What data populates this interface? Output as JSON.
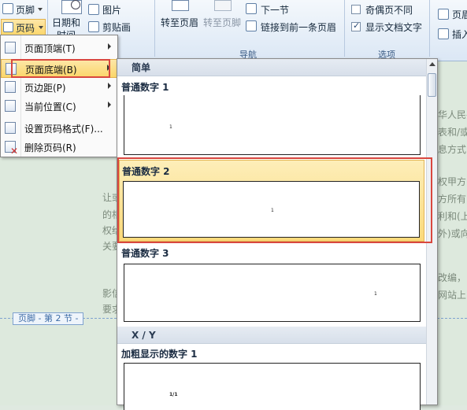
{
  "ribbon": {
    "header_footer": {
      "footer_label": "页脚",
      "page_number_label": "页码"
    },
    "insert": {
      "date_time_label": "日期和",
      "date_time_label2": "时间",
      "picture_label": "图片",
      "clipart_label": "剪贴画"
    },
    "nav": {
      "goto_header": "转至页眉",
      "goto_footer": "转至页脚",
      "next_section": "下一节",
      "link_previous": "链接到前一条页眉",
      "group_label": "导航"
    },
    "options": {
      "odd_even": "奇偶页不同",
      "show_doc_text": "显示文档文字",
      "group_label": "选项"
    },
    "position": {
      "header_label": "页眉",
      "insert_label": "插入"
    }
  },
  "menu": {
    "items": [
      {
        "label": "页面顶端(T)",
        "icon": "page-top-icon",
        "has_submenu": true
      },
      {
        "label": "页面底端(B)",
        "icon": "page-bottom-icon",
        "has_submenu": true
      },
      {
        "label": "页边距(P)",
        "icon": "page-margin-icon",
        "has_submenu": true
      },
      {
        "label": "当前位置(C)",
        "icon": "current-position-icon",
        "has_submenu": true
      },
      {
        "label": "设置页码格式(F)...",
        "icon": "format-page-number-icon",
        "has_submenu": false
      },
      {
        "label": "删除页码(R)",
        "icon": "delete-page-number-icon",
        "has_submenu": false
      }
    ]
  },
  "gallery": {
    "section_simple": "简单",
    "item1": "普通数字 1",
    "item2": "普通数字 2",
    "item3": "普通数字 3",
    "section_xy": "X / Y",
    "item4": "加粗显示的数字 1",
    "preview_number": "1",
    "preview_xy": "1/1"
  },
  "document": {
    "footer_tag": "页脚 - 第 2 节 -",
    "right_lines": [
      "华人民共",
      "表和/或",
      "息方式",
      "权甲方向",
      "方所有",
      "利和(上",
      "外)或向",
      "改编，",
      "网站上",
      ""
    ],
    "left_lines": [
      "让或",
      "的相",
      "权给",
      "关要",
      "影信",
      "要求"
    ]
  }
}
